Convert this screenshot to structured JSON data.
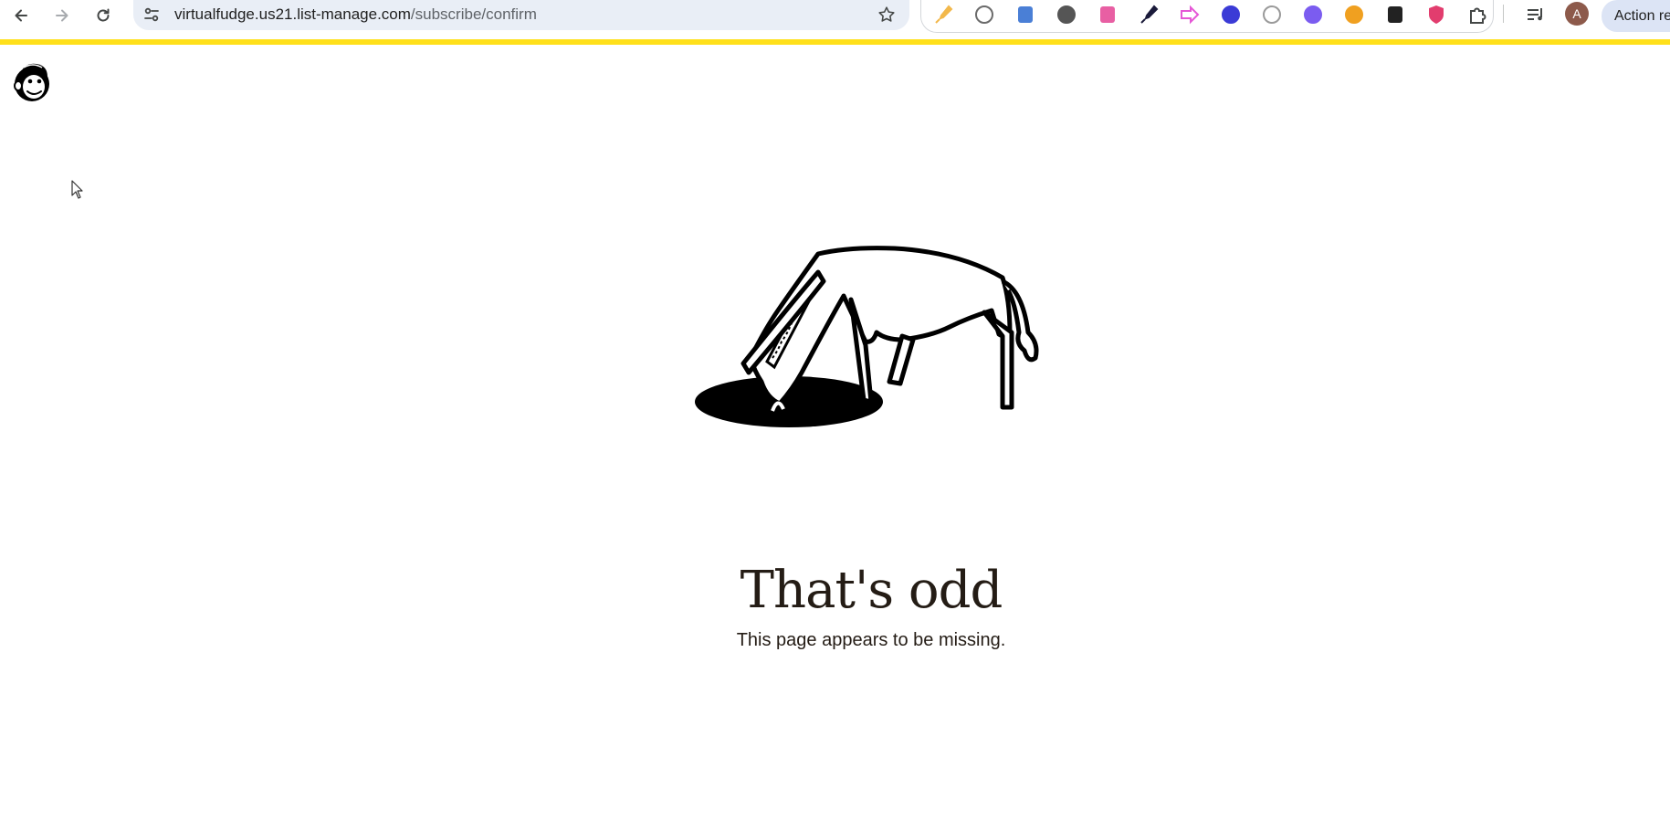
{
  "browser": {
    "url_host": "virtualfudge.us21.list-manage.com",
    "url_path": "/subscribe/confirm",
    "avatar_initial": "A",
    "action_button_label": "Action re",
    "extensions": [
      {
        "name": "highlighter-extension-icon",
        "color": "#f2b84b"
      },
      {
        "name": "wordtune-extension-icon",
        "color": "#6b6b6b"
      },
      {
        "name": "clipboard-extension-icon",
        "color": "#4a7fd6"
      },
      {
        "name": "record-extension-icon",
        "color": "#555555"
      },
      {
        "name": "gradient-extension-icon",
        "color": "#e85fa3"
      },
      {
        "name": "eyedropper-extension-icon",
        "color": "#1a1a3a"
      },
      {
        "name": "arrow-extension-icon",
        "color": "#e557d6"
      },
      {
        "name": "stripes-extension-icon",
        "color": "#3b3bd6"
      },
      {
        "name": "compass-extension-icon",
        "color": "#9a9a9a"
      },
      {
        "name": "screenshot-extension-icon",
        "color": "#7b5cf0"
      },
      {
        "name": "flame-extension-icon",
        "color": "#f0a020"
      },
      {
        "name": "font-finder-extension-icon",
        "color": "#222222"
      },
      {
        "name": "shield-extension-icon",
        "color": "#e23d6e"
      },
      {
        "name": "puzzle-extension-icon",
        "color": "#444746"
      }
    ]
  },
  "colors": {
    "accent_bar": "#ffe01b",
    "text": "#241c15"
  },
  "page": {
    "headline": "That's odd",
    "message": "This page appears to be missing."
  }
}
